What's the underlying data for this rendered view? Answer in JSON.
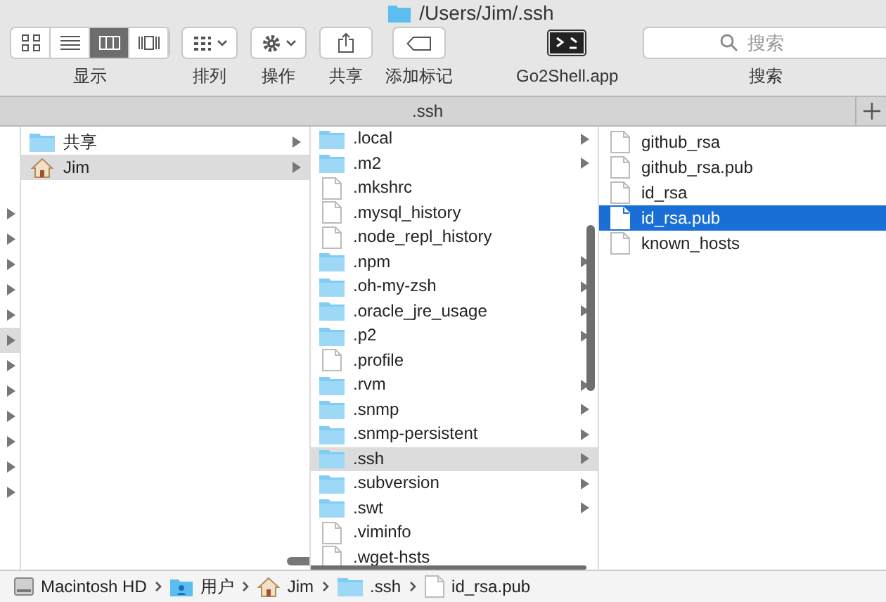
{
  "window": {
    "title": "/Users/Jim/.ssh"
  },
  "toolbar": {
    "view_modes": [
      {
        "kind": "icons",
        "selected": false
      },
      {
        "kind": "list",
        "selected": false
      },
      {
        "kind": "columns",
        "selected": true
      },
      {
        "kind": "gallery",
        "selected": false
      }
    ],
    "groups": [
      {
        "kind": "view",
        "label": "显示"
      },
      {
        "kind": "arrange",
        "label": "排列"
      },
      {
        "kind": "action",
        "label": "操作"
      },
      {
        "kind": "share",
        "label": "共享"
      },
      {
        "kind": "tag",
        "label": "添加标记"
      },
      {
        "kind": "app",
        "label": "Go2Shell.app"
      }
    ],
    "search": {
      "placeholder": "搜索",
      "label": "搜索"
    }
  },
  "tabs": [
    {
      "label": ".ssh",
      "selected": true
    }
  ],
  "column_0": [
    {
      "selected": false
    },
    {
      "selected": false
    },
    {
      "selected": false
    },
    {
      "selected": false
    },
    {
      "selected": false
    },
    {
      "selected": true
    },
    {
      "selected": false
    },
    {
      "selected": false
    },
    {
      "selected": false
    },
    {
      "selected": false
    },
    {
      "selected": false
    },
    {
      "selected": false
    }
  ],
  "column_1": [
    {
      "name": "共享",
      "kind": "folder",
      "selected": false
    },
    {
      "name": "Jim",
      "kind": "home",
      "selected": true
    }
  ],
  "column_2": [
    {
      "name": ".local",
      "kind": "folder",
      "selected": false
    },
    {
      "name": ".m2",
      "kind": "folder",
      "selected": false
    },
    {
      "name": ".mkshrc",
      "kind": "file",
      "selected": false
    },
    {
      "name": ".mysql_history",
      "kind": "file",
      "selected": false
    },
    {
      "name": ".node_repl_history",
      "kind": "file",
      "selected": false
    },
    {
      "name": ".npm",
      "kind": "folder",
      "selected": false
    },
    {
      "name": ".oh-my-zsh",
      "kind": "folder",
      "selected": false
    },
    {
      "name": ".oracle_jre_usage",
      "kind": "folder",
      "selected": false
    },
    {
      "name": ".p2",
      "kind": "folder",
      "selected": false
    },
    {
      "name": ".profile",
      "kind": "file",
      "selected": false
    },
    {
      "name": ".rvm",
      "kind": "folder",
      "selected": false
    },
    {
      "name": ".snmp",
      "kind": "folder",
      "selected": false
    },
    {
      "name": ".snmp-persistent",
      "kind": "folder",
      "selected": false
    },
    {
      "name": ".ssh",
      "kind": "folder",
      "selected": true
    },
    {
      "name": ".subversion",
      "kind": "folder",
      "selected": false
    },
    {
      "name": ".swt",
      "kind": "folder",
      "selected": false
    },
    {
      "name": ".viminfo",
      "kind": "file",
      "selected": false
    },
    {
      "name": ".wget-hsts",
      "kind": "file",
      "selected": false
    }
  ],
  "column_3": [
    {
      "name": "github_rsa",
      "kind": "file",
      "selected": false
    },
    {
      "name": "github_rsa.pub",
      "kind": "file",
      "selected": false
    },
    {
      "name": "id_rsa",
      "kind": "file",
      "selected": false
    },
    {
      "name": "id_rsa.pub",
      "kind": "file",
      "selected": true
    },
    {
      "name": "known_hosts",
      "kind": "file",
      "selected": false
    }
  ],
  "path_bar": [
    {
      "name": "Macintosh HD",
      "kind": "disk"
    },
    {
      "name": "用户",
      "kind": "users"
    },
    {
      "name": "Jim",
      "kind": "home"
    },
    {
      "name": ".ssh",
      "kind": "folder"
    },
    {
      "name": "id_rsa.pub",
      "kind": "file"
    }
  ]
}
